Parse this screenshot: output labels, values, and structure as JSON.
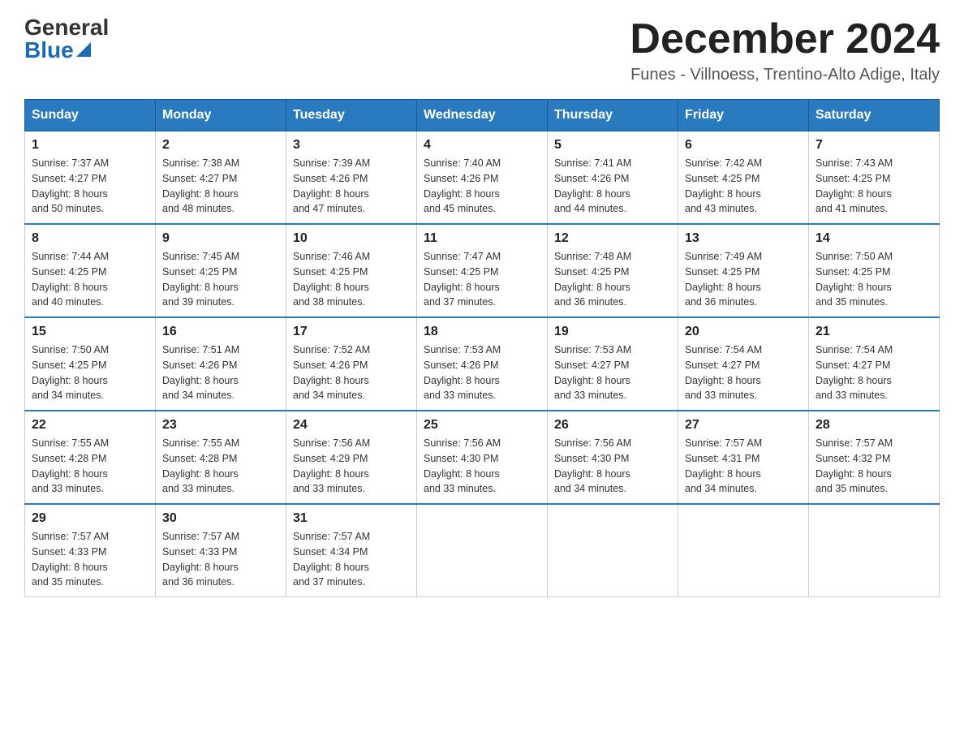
{
  "header": {
    "logo_general": "General",
    "logo_blue": "Blue",
    "month_year": "December 2024",
    "location": "Funes - Villnoess, Trentino-Alto Adige, Italy"
  },
  "days_of_week": [
    "Sunday",
    "Monday",
    "Tuesday",
    "Wednesday",
    "Thursday",
    "Friday",
    "Saturday"
  ],
  "weeks": [
    [
      {
        "num": "1",
        "sunrise": "7:37 AM",
        "sunset": "4:27 PM",
        "daylight": "8 hours and 50 minutes."
      },
      {
        "num": "2",
        "sunrise": "7:38 AM",
        "sunset": "4:27 PM",
        "daylight": "8 hours and 48 minutes."
      },
      {
        "num": "3",
        "sunrise": "7:39 AM",
        "sunset": "4:26 PM",
        "daylight": "8 hours and 47 minutes."
      },
      {
        "num": "4",
        "sunrise": "7:40 AM",
        "sunset": "4:26 PM",
        "daylight": "8 hours and 45 minutes."
      },
      {
        "num": "5",
        "sunrise": "7:41 AM",
        "sunset": "4:26 PM",
        "daylight": "8 hours and 44 minutes."
      },
      {
        "num": "6",
        "sunrise": "7:42 AM",
        "sunset": "4:25 PM",
        "daylight": "8 hours and 43 minutes."
      },
      {
        "num": "7",
        "sunrise": "7:43 AM",
        "sunset": "4:25 PM",
        "daylight": "8 hours and 41 minutes."
      }
    ],
    [
      {
        "num": "8",
        "sunrise": "7:44 AM",
        "sunset": "4:25 PM",
        "daylight": "8 hours and 40 minutes."
      },
      {
        "num": "9",
        "sunrise": "7:45 AM",
        "sunset": "4:25 PM",
        "daylight": "8 hours and 39 minutes."
      },
      {
        "num": "10",
        "sunrise": "7:46 AM",
        "sunset": "4:25 PM",
        "daylight": "8 hours and 38 minutes."
      },
      {
        "num": "11",
        "sunrise": "7:47 AM",
        "sunset": "4:25 PM",
        "daylight": "8 hours and 37 minutes."
      },
      {
        "num": "12",
        "sunrise": "7:48 AM",
        "sunset": "4:25 PM",
        "daylight": "8 hours and 36 minutes."
      },
      {
        "num": "13",
        "sunrise": "7:49 AM",
        "sunset": "4:25 PM",
        "daylight": "8 hours and 36 minutes."
      },
      {
        "num": "14",
        "sunrise": "7:50 AM",
        "sunset": "4:25 PM",
        "daylight": "8 hours and 35 minutes."
      }
    ],
    [
      {
        "num": "15",
        "sunrise": "7:50 AM",
        "sunset": "4:25 PM",
        "daylight": "8 hours and 34 minutes."
      },
      {
        "num": "16",
        "sunrise": "7:51 AM",
        "sunset": "4:26 PM",
        "daylight": "8 hours and 34 minutes."
      },
      {
        "num": "17",
        "sunrise": "7:52 AM",
        "sunset": "4:26 PM",
        "daylight": "8 hours and 34 minutes."
      },
      {
        "num": "18",
        "sunrise": "7:53 AM",
        "sunset": "4:26 PM",
        "daylight": "8 hours and 33 minutes."
      },
      {
        "num": "19",
        "sunrise": "7:53 AM",
        "sunset": "4:27 PM",
        "daylight": "8 hours and 33 minutes."
      },
      {
        "num": "20",
        "sunrise": "7:54 AM",
        "sunset": "4:27 PM",
        "daylight": "8 hours and 33 minutes."
      },
      {
        "num": "21",
        "sunrise": "7:54 AM",
        "sunset": "4:27 PM",
        "daylight": "8 hours and 33 minutes."
      }
    ],
    [
      {
        "num": "22",
        "sunrise": "7:55 AM",
        "sunset": "4:28 PM",
        "daylight": "8 hours and 33 minutes."
      },
      {
        "num": "23",
        "sunrise": "7:55 AM",
        "sunset": "4:28 PM",
        "daylight": "8 hours and 33 minutes."
      },
      {
        "num": "24",
        "sunrise": "7:56 AM",
        "sunset": "4:29 PM",
        "daylight": "8 hours and 33 minutes."
      },
      {
        "num": "25",
        "sunrise": "7:56 AM",
        "sunset": "4:30 PM",
        "daylight": "8 hours and 33 minutes."
      },
      {
        "num": "26",
        "sunrise": "7:56 AM",
        "sunset": "4:30 PM",
        "daylight": "8 hours and 34 minutes."
      },
      {
        "num": "27",
        "sunrise": "7:57 AM",
        "sunset": "4:31 PM",
        "daylight": "8 hours and 34 minutes."
      },
      {
        "num": "28",
        "sunrise": "7:57 AM",
        "sunset": "4:32 PM",
        "daylight": "8 hours and 35 minutes."
      }
    ],
    [
      {
        "num": "29",
        "sunrise": "7:57 AM",
        "sunset": "4:33 PM",
        "daylight": "8 hours and 35 minutes."
      },
      {
        "num": "30",
        "sunrise": "7:57 AM",
        "sunset": "4:33 PM",
        "daylight": "8 hours and 36 minutes."
      },
      {
        "num": "31",
        "sunrise": "7:57 AM",
        "sunset": "4:34 PM",
        "daylight": "8 hours and 37 minutes."
      },
      null,
      null,
      null,
      null
    ]
  ]
}
